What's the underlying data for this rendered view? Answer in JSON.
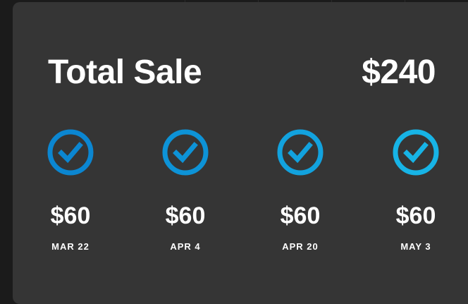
{
  "card": {
    "title": "Total Sale",
    "total": "$240"
  },
  "steps": [
    {
      "amount": "$60",
      "date": "MAR 22",
      "completed": true
    },
    {
      "amount": "$60",
      "date": "APR 4",
      "completed": true
    },
    {
      "amount": "$60",
      "date": "APR 20",
      "completed": true
    },
    {
      "amount": "$60",
      "date": "MAY 3",
      "completed": true
    }
  ],
  "colors": {
    "card_background": "#353535",
    "page_background": "#1b1b1b",
    "accent_start": "#0a84d0",
    "accent_end": "#17b4e6",
    "text": "#ffffff"
  },
  "icons": {
    "step": "check-icon"
  }
}
